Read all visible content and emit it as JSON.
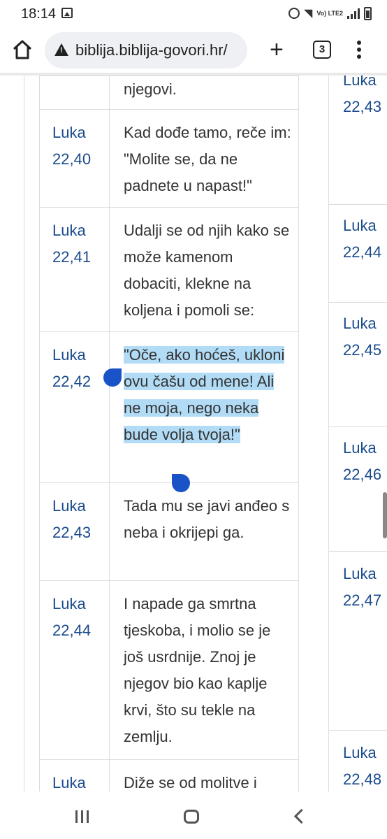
{
  "status": {
    "time": "18:14",
    "network": "Vo) LTE2"
  },
  "browser": {
    "url": "biblija.biblija-govori.hr/",
    "tab_count": "3"
  },
  "left_table": [
    {
      "ref": [
        "",
        ""
      ],
      "text": "njegovi."
    },
    {
      "ref": [
        "Luka",
        "22,40"
      ],
      "text": "Kad dođe tamo, reče im: \"Molite se, da ne padnete u napast!\""
    },
    {
      "ref": [
        "Luka",
        "22,41"
      ],
      "text": "Udalji se od njih kako se može kamenom dobaciti, klekne na koljena i pomoli se:"
    },
    {
      "ref": [
        "Luka",
        "22,42"
      ],
      "text": "\"Oče, ako hoćeš, ukloni ovu čašu od mene! Ali ne moja, nego neka bude volja tvoja!\""
    },
    {
      "ref": [
        "Luka",
        "22,43"
      ],
      "text": "Tada mu se javi anđeo s neba i okrijepi ga."
    },
    {
      "ref": [
        "Luka",
        "22,44"
      ],
      "text": "I napade ga smrtna tjeskoba, i molio se je još usrdnije. Znoj je njegov bio kao kaplje krvi, što su tekle na zemlju."
    },
    {
      "ref": [
        "Luka",
        ""
      ],
      "text": "Diže se od molitve i"
    }
  ],
  "right_column": [
    {
      "ref": [
        "Luka",
        "22,43"
      ]
    },
    {
      "ref": [
        "Luka",
        "22,44"
      ]
    },
    {
      "ref": [
        "Luka",
        "22,45"
      ]
    },
    {
      "ref": [
        "Luka",
        "22,46"
      ]
    },
    {
      "ref": [
        "Luka",
        "22,47"
      ]
    },
    {
      "ref": [
        "Luka",
        "22,48"
      ]
    }
  ],
  "selection": {
    "text": "\"Oče, ako hoćeš, ukloni ovu čašu od mene! Ali ne moja, nego neka bude volja tvoja!\"",
    "color": "#b2dcf6"
  }
}
